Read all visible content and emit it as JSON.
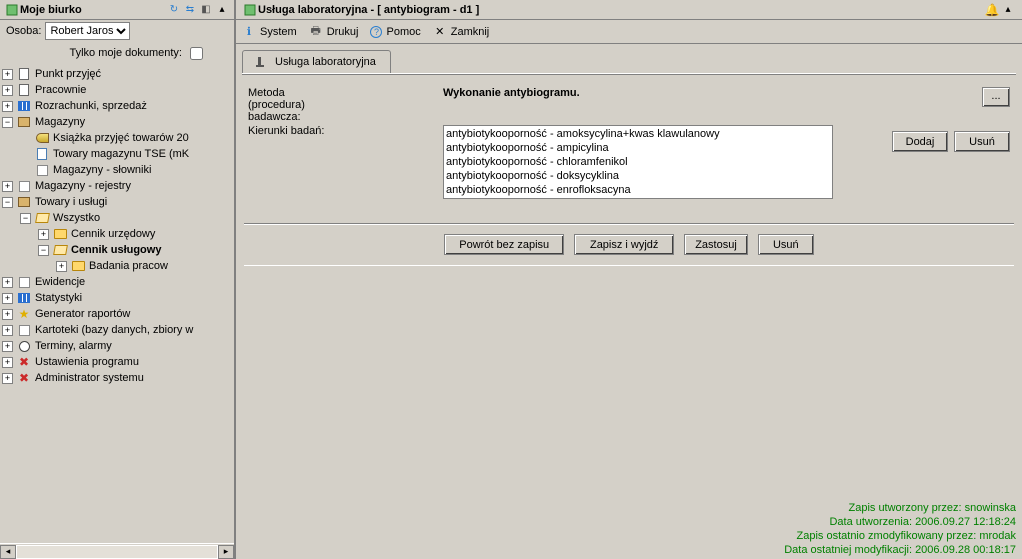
{
  "left": {
    "title": "Moje biurko",
    "person_label": "Osoba:",
    "persons": [
      "Robert Jaros"
    ],
    "only_my_docs_label": "Tylko moje dokumenty:",
    "tree": [
      {
        "d": 0,
        "exp": "+",
        "icon": "doc",
        "label": "Punkt przyjęć"
      },
      {
        "d": 0,
        "exp": "+",
        "icon": "doc",
        "label": "Pracownie"
      },
      {
        "d": 0,
        "exp": "+",
        "icon": "chart",
        "label": "Rozrachunki, sprzedaż"
      },
      {
        "d": 0,
        "exp": "-",
        "icon": "box",
        "label": "Magazyny"
      },
      {
        "d": 1,
        "exp": "",
        "icon": "key",
        "label": "Książka przyjęć towarów 20"
      },
      {
        "d": 1,
        "exp": "",
        "icon": "page",
        "label": "Towary magazynu TSE (mK"
      },
      {
        "d": 1,
        "exp": "",
        "icon": "note",
        "label": "Magazyny - słowniki"
      },
      {
        "d": 0,
        "exp": "+",
        "icon": "note",
        "label": "Magazyny - rejestry"
      },
      {
        "d": 0,
        "exp": "-",
        "icon": "box",
        "label": "Towary i usługi"
      },
      {
        "d": 1,
        "exp": "-",
        "icon": "folder-open",
        "label": "Wszystko"
      },
      {
        "d": 2,
        "exp": "+",
        "icon": "folder",
        "label": "Cennik urzędowy"
      },
      {
        "d": 2,
        "exp": "-",
        "icon": "folder-open",
        "label": "Cennik usługowy",
        "bold": true
      },
      {
        "d": 3,
        "exp": "+",
        "icon": "folder",
        "label": "Badania pracow"
      },
      {
        "d": 0,
        "exp": "+",
        "icon": "note",
        "label": "Ewidencje"
      },
      {
        "d": 0,
        "exp": "+",
        "icon": "chart",
        "label": "Statystyki"
      },
      {
        "d": 0,
        "exp": "+",
        "icon": "star",
        "label": "Generator raportów"
      },
      {
        "d": 0,
        "exp": "+",
        "icon": "note",
        "label": "Kartoteki (bazy danych, zbiory w"
      },
      {
        "d": 0,
        "exp": "+",
        "icon": "clock",
        "label": "Terminy, alarmy"
      },
      {
        "d": 0,
        "exp": "+",
        "icon": "tools",
        "label": "Ustawienia programu"
      },
      {
        "d": 0,
        "exp": "+",
        "icon": "tools",
        "label": "Administrator systemu"
      }
    ]
  },
  "right": {
    "title": "Usługa laboratoryjna - [ antybiogram - d1 ]",
    "toolbar": {
      "system": "System",
      "print": "Drukuj",
      "help": "Pomoc",
      "close": "Zamknij"
    },
    "tab_label": "Usługa laboratoryjna",
    "labels": {
      "method1": "Metoda",
      "method2": "(procedura)",
      "method3": "badawcza:",
      "directions": "Kierunki badań:"
    },
    "method_value": "Wykonanie antybiogramu.",
    "list": [
      "antybiotykooporność - amoksycylina+kwas klawulanowy",
      "antybiotykooporność - ampicylina",
      "antybiotykooporność - chloramfenikol",
      "antybiotykooporność - doksycyklina",
      "antybiotykooporność - enrofloksacyna"
    ],
    "btn": {
      "ellipsis": "...",
      "add": "Dodaj",
      "remove_side": "Usuń",
      "back": "Powrót bez zapisu",
      "save_exit": "Zapisz i wyjdź",
      "apply": "Zastosuj",
      "remove": "Usuń"
    },
    "audit": {
      "a1": "Zapis utworzony przez: snowinska",
      "a2": "Data utworzenia: 2006.09.27 12:18:24",
      "a3": "Zapis ostatnio zmodyfikowany przez: mrodak",
      "a4": "Data ostatniej modyfikacji: 2006.09.28 00:18:17"
    }
  }
}
